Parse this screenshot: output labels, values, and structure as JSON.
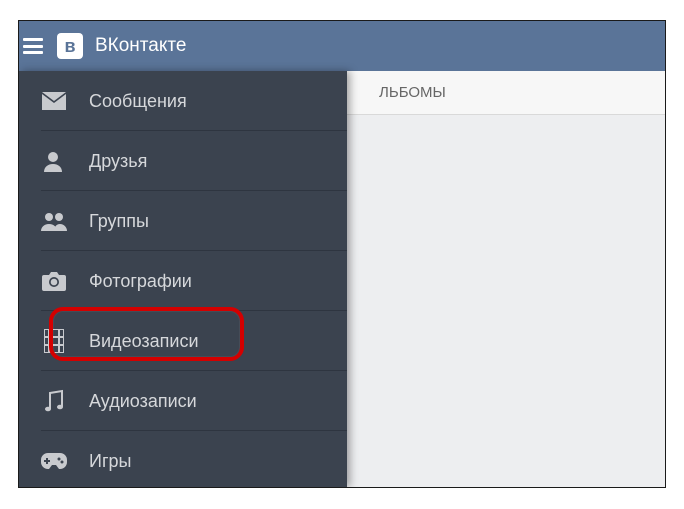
{
  "header": {
    "logo_letter": "в",
    "title": "ВКонтакте"
  },
  "background_tab": "ЛЬБОМЫ",
  "sidebar": {
    "items": [
      {
        "label": "Сообщения",
        "icon": "envelope-icon"
      },
      {
        "label": "Друзья",
        "icon": "user-icon"
      },
      {
        "label": "Группы",
        "icon": "users-icon"
      },
      {
        "label": "Фотографии",
        "icon": "camera-icon"
      },
      {
        "label": "Видеозаписи",
        "icon": "film-icon"
      },
      {
        "label": "Аудиозаписи",
        "icon": "music-icon"
      },
      {
        "label": "Игры",
        "icon": "gamepad-icon"
      }
    ]
  },
  "highlighted_index": 4,
  "colors": {
    "header_bg": "#5a7498",
    "drawer_bg": "#3b434f",
    "highlight": "#d40000"
  }
}
